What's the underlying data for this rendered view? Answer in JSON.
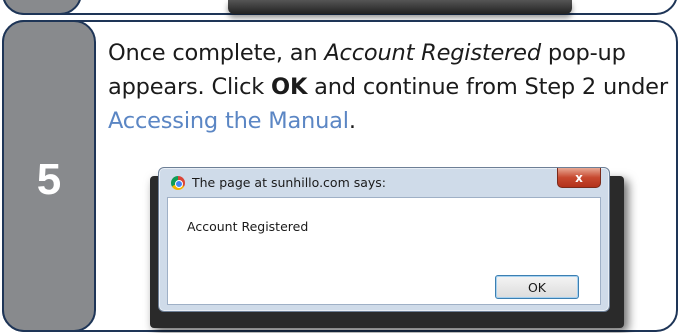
{
  "step": {
    "number": "5",
    "text_before_italic": "Once complete, an ",
    "italic": "Account Registered",
    "text_mid": " pop-up appears. Click ",
    "bold": "OK",
    "text_after_bold": " and continue from Step 2 under ",
    "link": "Accessing the Manual",
    "text_end": "."
  },
  "dialog": {
    "title": "The page at sunhillo.com says:",
    "close_glyph": "x",
    "message": "Account Registered",
    "ok_label": "OK"
  },
  "colors": {
    "border": "#1e3557",
    "tab_gray": "#888a8d",
    "link": "#5b86c4"
  }
}
